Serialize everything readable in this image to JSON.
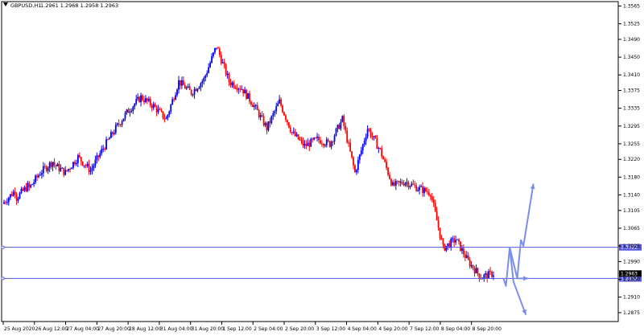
{
  "chart_data": {
    "type": "candlestick",
    "header": {
      "symbol": "GBPUSD,H1",
      "ohlc": "1.2961 1.2968 1.2958 1.2963"
    },
    "ylim": [
      1.2855,
      1.3575
    ],
    "y_ticks": [
      "1.3565",
      "1.3525",
      "1.3490",
      "1.3450",
      "1.3410",
      "1.3375",
      "1.3335",
      "1.3295",
      "1.3255",
      "1.3220",
      "1.3180",
      "1.3140",
      "1.3105",
      "1.3065",
      "1.3025",
      "1.2990",
      "1.2950",
      "1.2910",
      "1.2875"
    ],
    "x_ticks": [
      "25 Aug 2020",
      "26 Aug 12:00",
      "27 Aug 04:00",
      "27 Aug 20:00",
      "28 Aug 12:00",
      "31 Aug 04:00",
      "31 Aug 20:00",
      "1 Sep 12:00",
      "2 Sep 04:00",
      "2 Sep 20:00",
      "3 Sep 12:00",
      "4 Sep 04:00",
      "4 Sep 20:00",
      "7 Sep 12:00",
      "8 Sep 04:00",
      "8 Sep 20:00"
    ],
    "bull_color": "#0000ff",
    "bear_color": "#ff0000",
    "level_color": "#5555dd",
    "arrow_color": "#7b8fea",
    "current_price": "1.2963",
    "levels": [
      {
        "price": 1.3022,
        "label": "1.3022"
      },
      {
        "price": 1.2952,
        "label": "1.2952"
      }
    ],
    "path_anchors": [
      [
        1.312,
        1.315
      ],
      [
        1.313,
        1.316
      ],
      [
        1.315,
        1.319
      ],
      [
        1.319,
        1.3215
      ],
      [
        1.321,
        1.319
      ],
      [
        1.319,
        1.3225
      ],
      [
        1.3225,
        1.3195
      ],
      [
        1.3195,
        1.3245
      ],
      [
        1.3245,
        1.329
      ],
      [
        1.329,
        1.333
      ],
      [
        1.333,
        1.336
      ],
      [
        1.336,
        1.334
      ],
      [
        1.334,
        1.331
      ],
      [
        1.331,
        1.3395
      ],
      [
        1.3395,
        1.337
      ],
      [
        1.337,
        1.34
      ],
      [
        1.34,
        1.3475
      ],
      [
        1.3475,
        1.3395
      ],
      [
        1.3395,
        1.338
      ],
      [
        1.338,
        1.334
      ],
      [
        1.334,
        1.329
      ],
      [
        1.329,
        1.335
      ],
      [
        1.335,
        1.328
      ],
      [
        1.328,
        1.325
      ],
      [
        1.325,
        1.3265
      ],
      [
        1.3265,
        1.3255
      ],
      [
        1.3255,
        1.331
      ],
      [
        1.331,
        1.319
      ],
      [
        1.319,
        1.329
      ],
      [
        1.329,
        1.324
      ],
      [
        1.324,
        1.316
      ],
      [
        1.316,
        1.317
      ],
      [
        1.317,
        1.3155
      ],
      [
        1.3155,
        1.3145
      ],
      [
        1.3145,
        1.302
      ],
      [
        1.302,
        1.304
      ],
      [
        1.304,
        1.299
      ],
      [
        1.299,
        1.2955
      ],
      [
        1.2955,
        1.2963
      ]
    ],
    "projection_paths": [
      [
        [
          8,
          1.2952
        ],
        [
          10,
          1.2935
        ],
        [
          13,
          1.3022
        ],
        [
          16,
          1.2945
        ],
        [
          26,
          1.287
        ]
      ],
      [
        [
          13,
          1.3022
        ],
        [
          19,
          1.2952
        ],
        [
          28,
          1.2952
        ]
      ],
      [
        [
          19,
          1.2952
        ],
        [
          22,
          1.3038
        ],
        [
          24,
          1.3025
        ],
        [
          32,
          1.3165
        ]
      ]
    ]
  }
}
